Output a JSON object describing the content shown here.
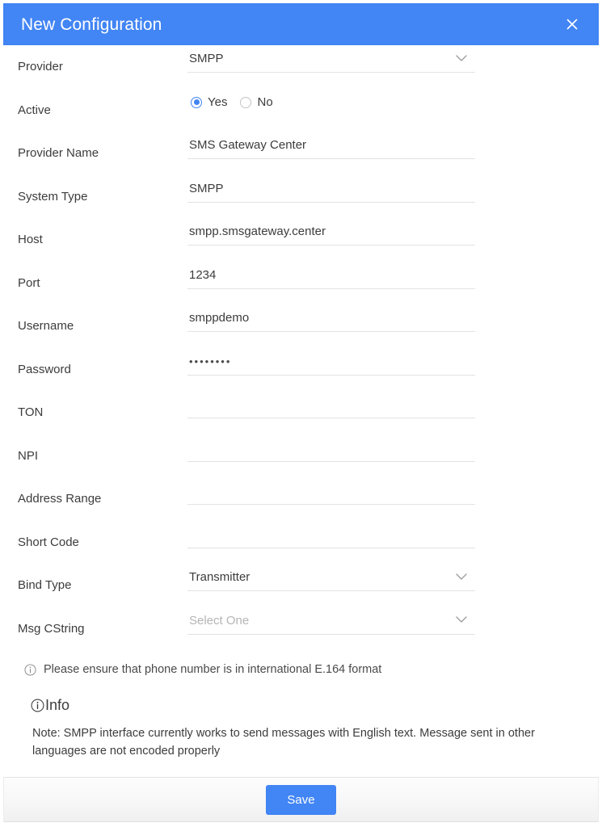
{
  "header": {
    "title": "New Configuration",
    "close_icon": "close-icon"
  },
  "form": {
    "rows": [
      {
        "label": "Provider",
        "type": "select",
        "value": "SMPP",
        "placeholder": ""
      },
      {
        "label": "Active",
        "type": "radio",
        "value": "Yes",
        "options": [
          {
            "label": "Yes",
            "checked": true
          },
          {
            "label": "No",
            "checked": false
          }
        ]
      },
      {
        "label": "Provider Name",
        "type": "text",
        "value": "SMS Gateway Center",
        "placeholder": ""
      },
      {
        "label": "System Type",
        "type": "text",
        "value": "SMPP",
        "placeholder": ""
      },
      {
        "label": "Host",
        "type": "text",
        "value": "smpp.smsgateway.center",
        "placeholder": ""
      },
      {
        "label": "Port",
        "type": "text",
        "value": "1234",
        "placeholder": ""
      },
      {
        "label": "Username",
        "type": "text",
        "value": "smppdemo",
        "placeholder": ""
      },
      {
        "label": "Password",
        "type": "password",
        "value": "••••••••",
        "placeholder": ""
      },
      {
        "label": "TON",
        "type": "text",
        "value": "",
        "placeholder": ""
      },
      {
        "label": "NPI",
        "type": "text",
        "value": "",
        "placeholder": ""
      },
      {
        "label": "Address Range",
        "type": "text",
        "value": "",
        "placeholder": ""
      },
      {
        "label": "Short Code",
        "type": "text",
        "value": "",
        "placeholder": ""
      },
      {
        "label": "Bind Type",
        "type": "select",
        "value": "Transmitter",
        "placeholder": ""
      },
      {
        "label": "Msg CString",
        "type": "select",
        "value": "",
        "placeholder": "Select One"
      }
    ]
  },
  "notes": {
    "hint": "Please ensure that phone number is in international E.164 format",
    "hint_icon": "info-circle-icon",
    "info_heading": "Info",
    "info_heading_icon": "info-circle-icon",
    "info_text": "Note: SMPP interface currently works to send messages with English text. Message sent in other languages are not encoded properly"
  },
  "footer": {
    "save_label": "Save"
  },
  "colors": {
    "accent": "#4285f4",
    "header_bg": "#4285f4",
    "text": "#3c3c3c",
    "placeholder": "#b5b5b5",
    "underline": "#e3e3e3"
  }
}
